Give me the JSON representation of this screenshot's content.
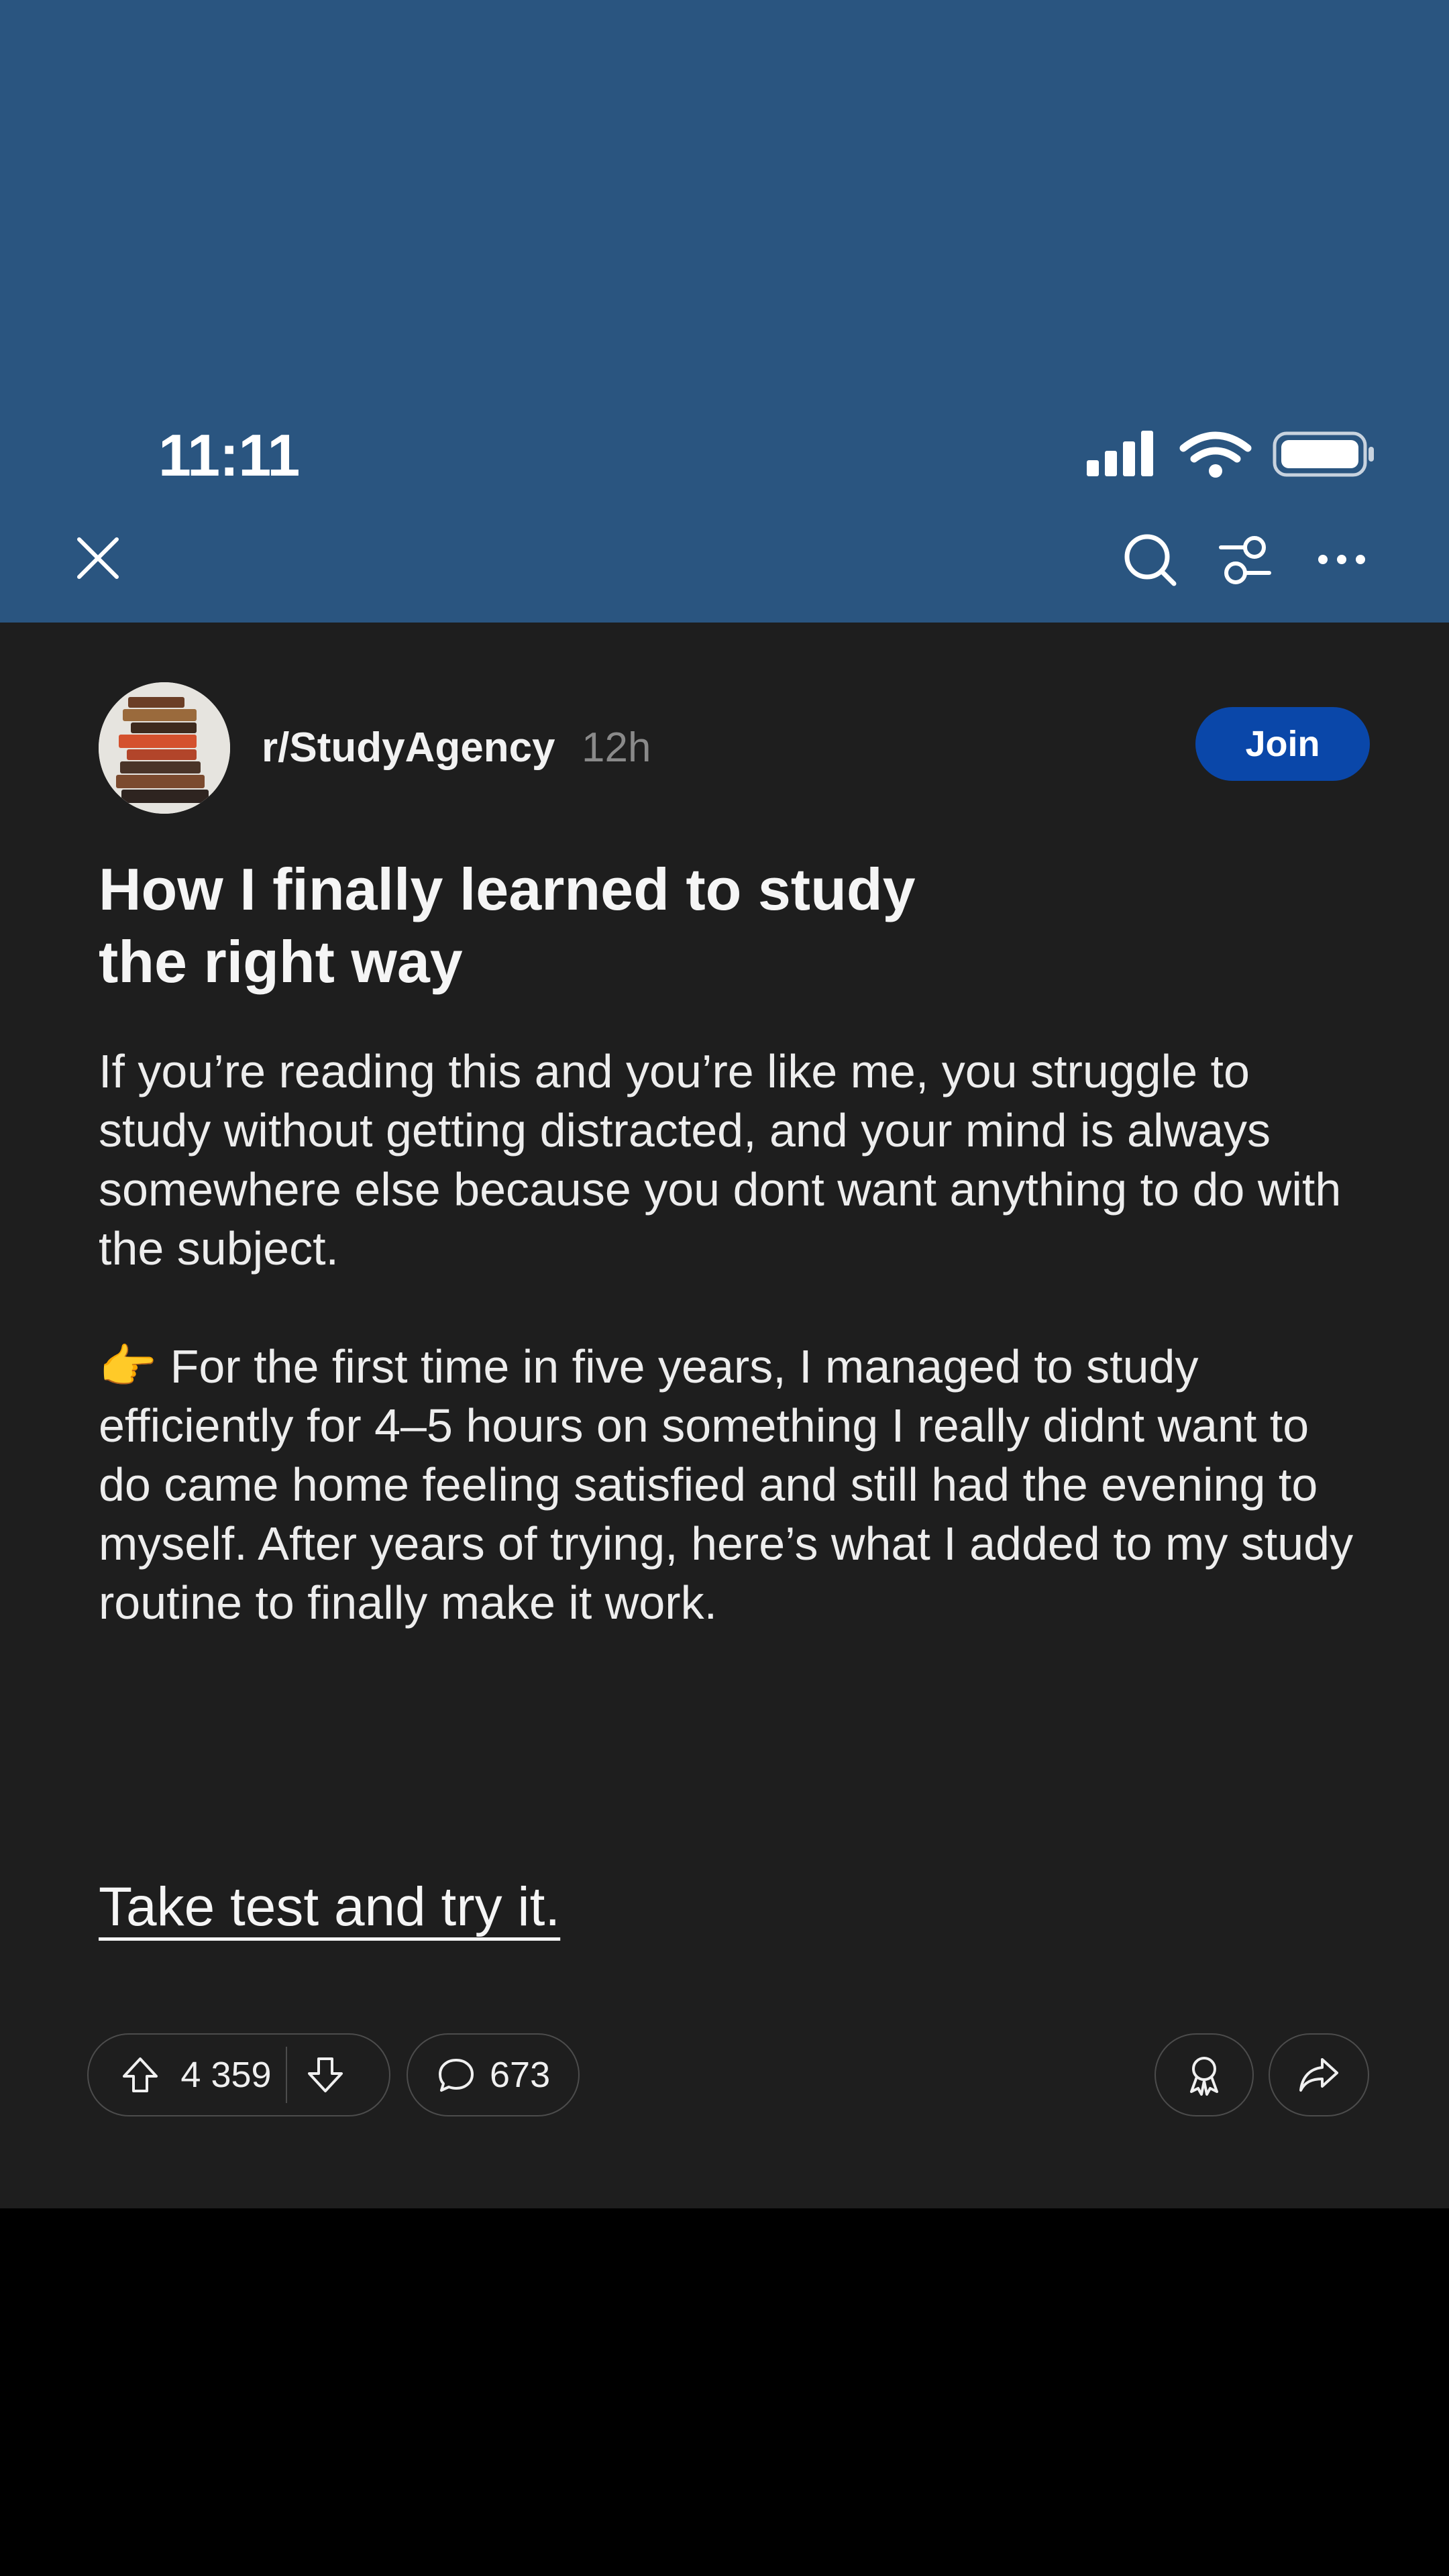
{
  "status_bar": {
    "time": "11:11"
  },
  "nav": {
    "close_icon": "close-icon",
    "search_icon": "search-icon",
    "filter_icon": "filter-icon",
    "more_icon": "more-icon"
  },
  "post": {
    "subreddit": "r/StudyAgency",
    "age": "12h",
    "join_label": "Join",
    "title": "How I finally learned to study the right way",
    "body_p1": "If you’re reading this and you’re like me, you struggle to study without getting distracted, and your mind is always somewhere else because you dont want anything to do with the subject.",
    "body_p2_emoji": "👉",
    "body_p2": "For the first time in five years, I managed to study efficiently for 4–5 hours on something I really didnt want to do came home feeling satisfied and still had the evening to myself. After years of trying, here’s what I added to my study routine to finally make it work.",
    "cta_link": "Take test and try it."
  },
  "actions": {
    "upvotes": "4 359",
    "comments": "673"
  },
  "colors": {
    "header_bg": "#2a5580",
    "content_bg": "#1e1e1e",
    "join_bg": "#0a47a9"
  }
}
